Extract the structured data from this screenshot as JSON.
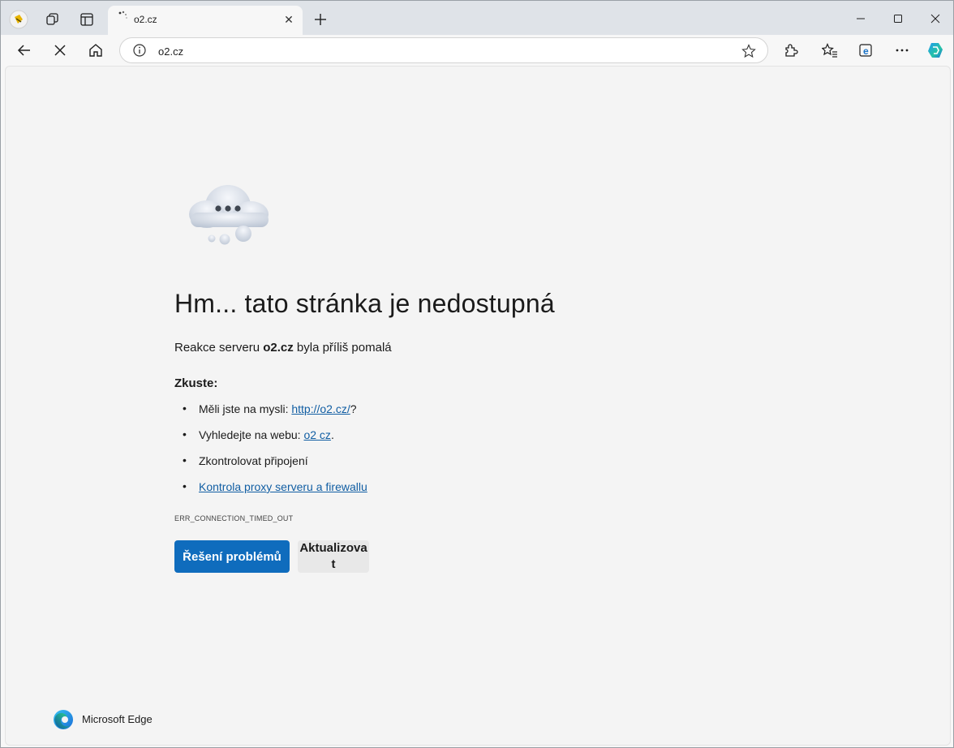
{
  "browser": {
    "tab": {
      "title": "o2.cz",
      "close_glyph": "✕"
    },
    "new_tab_glyph": "+",
    "address_bar": {
      "url": "o2.cz"
    },
    "icons": {
      "profile": "profile-avatar-icon",
      "workspaces": "workspaces-icon",
      "tab_actions": "vertical-tabs-icon",
      "back": "back-arrow-icon",
      "stop": "stop-loading-icon",
      "home": "home-icon",
      "info": "site-info-icon",
      "favorite": "star-icon",
      "extensions": "extensions-icon",
      "favorites": "favorites-icon",
      "ie_mode": "ie-mode-icon",
      "more": "more-icon",
      "copilot": "copilot-icon"
    }
  },
  "error_page": {
    "headline": "Hm... tato stránka je nedostupná",
    "subline_prefix": "Reakce serveru ",
    "subline_host": "o2.cz",
    "subline_suffix": " byla příliš pomalá",
    "try_heading": "Zkuste:",
    "tips": [
      {
        "prefix": "Měli jste na mysli: ",
        "link": "http://o2.cz/",
        "suffix": "?"
      },
      {
        "prefix": "Vyhledejte na webu: ",
        "link": "o2 cz",
        "suffix": "."
      },
      {
        "prefix": "Zkontrolovat připojení",
        "link": "",
        "suffix": ""
      },
      {
        "prefix": "",
        "link": "Kontrola proxy serveru a firewallu",
        "suffix": ""
      }
    ],
    "error_code": "ERR_CONNECTION_TIMED_OUT",
    "buttons": {
      "troubleshoot": "Řešení problémů",
      "refresh": "Aktualizovat"
    },
    "brand": "Microsoft Edge"
  },
  "colors": {
    "primary_button": "#0f6cbd",
    "link": "#115ea3",
    "tabstrip": "#dfe3e8"
  }
}
